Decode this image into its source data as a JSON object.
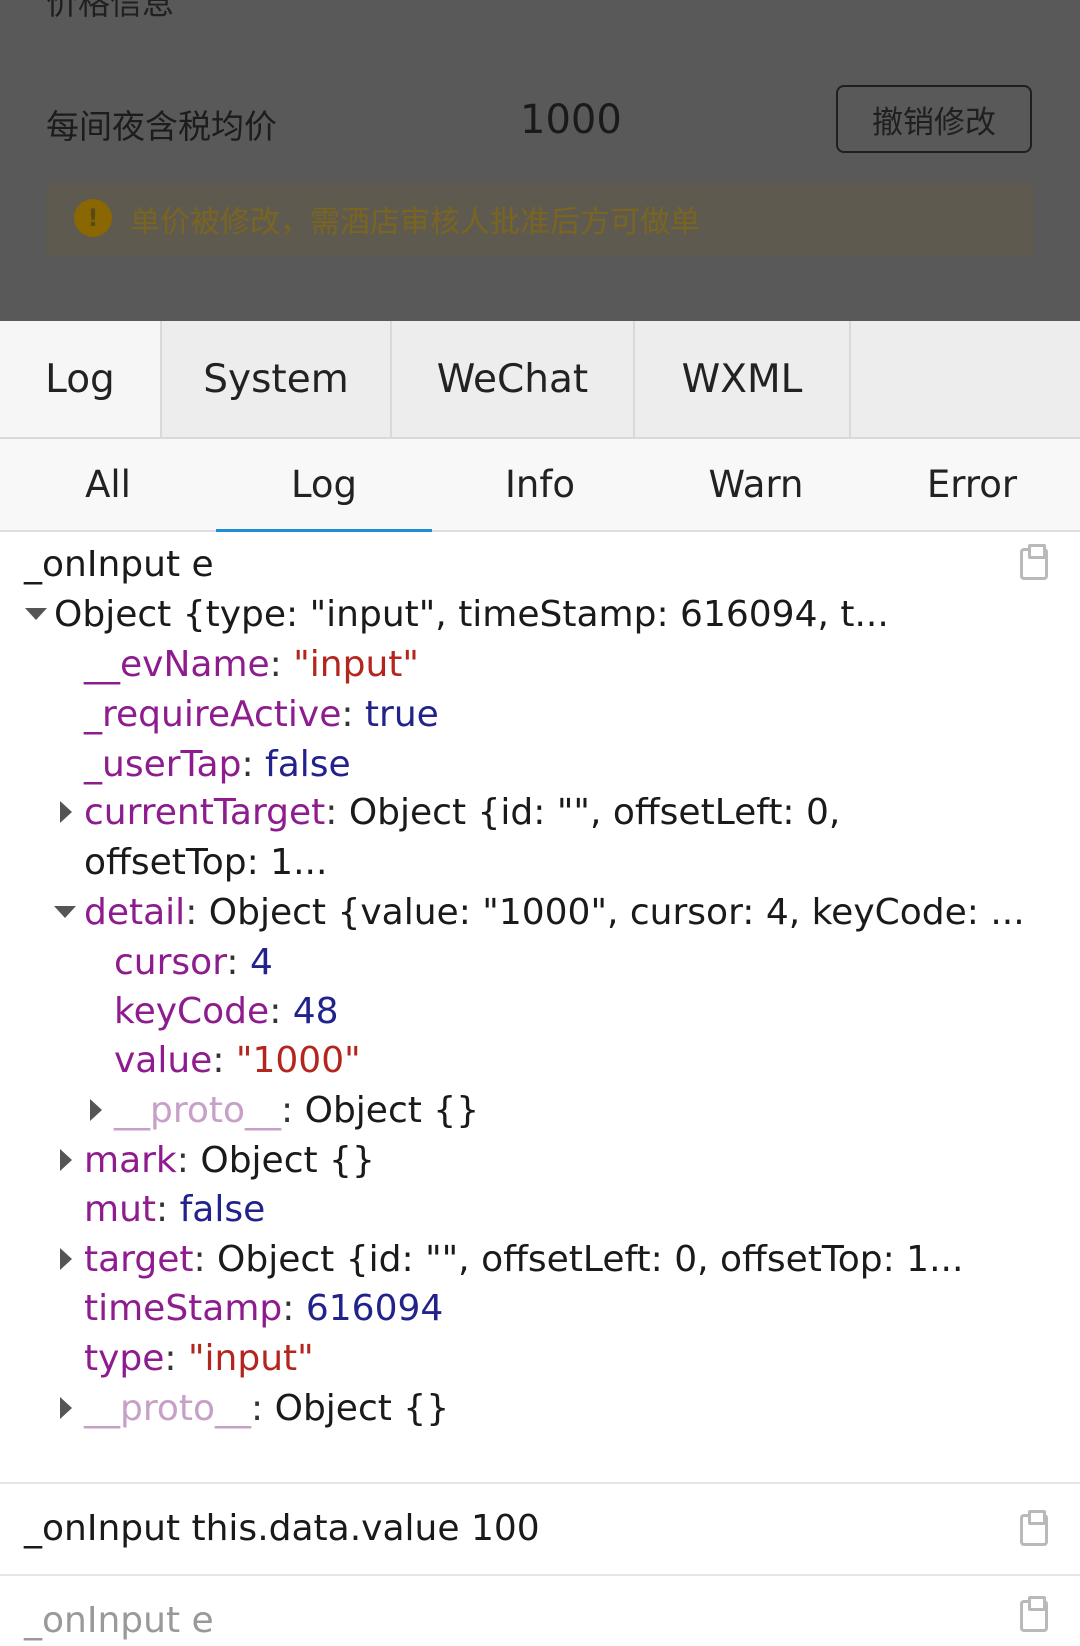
{
  "page": {
    "section_title": "价格信息",
    "price_label": "每间夜含税均价",
    "price_value": "1000",
    "revert_button": "撤销修改",
    "warning_text": "单价被修改，需酒店审核人批准后方可做单",
    "warning_icon": "!"
  },
  "console": {
    "tabs": [
      "Log",
      "System",
      "WeChat",
      "WXML"
    ],
    "active_tab": "Log",
    "levels": [
      "All",
      "Log",
      "Info",
      "Warn",
      "Error"
    ],
    "active_level": "Log"
  },
  "entries": {
    "e1": {
      "title": "_onInput e",
      "summary": "Object {type: \"input\", timeStamp: 616094, t...",
      "evName_key": "__evName",
      "evName_val": "\"input\"",
      "requireActive_key": "_requireActive",
      "requireActive_val": "true",
      "userTap_key": "_userTap",
      "userTap_val": "false",
      "currentTarget_key": "currentTarget",
      "currentTarget_val1": "Object {id: \"\", offsetLeft: 0,",
      "currentTarget_val2": "offsetTop: 1...",
      "detail_key": "detail",
      "detail_val": "Object {value: \"1000\", cursor: 4, keyCode: ...",
      "cursor_key": "cursor",
      "cursor_val": "4",
      "keyCode_key": "keyCode",
      "keyCode_val": "48",
      "value_key": "value",
      "value_val": "\"1000\"",
      "proto1_key": "__proto__",
      "proto1_val": "Object {}",
      "mark_key": "mark",
      "mark_val": "Object {}",
      "mut_key": "mut",
      "mut_val": "false",
      "target_key": "target",
      "target_val": "Object {id: \"\", offsetLeft: 0, offsetTop: 1...",
      "timeStamp_key": "timeStamp",
      "timeStamp_val": "616094",
      "type_key": "type",
      "type_val": "\"input\"",
      "proto2_key": "__proto__",
      "proto2_val": "Object {}"
    },
    "e2": {
      "title": "_onInput this.data.value 100"
    },
    "e3": {
      "title": "_onInput e"
    }
  },
  "colors": {
    "key": "#8e1c8e",
    "string": "#b3261e",
    "keyword": "#22228c",
    "active_underline": "#1f8dd6"
  }
}
